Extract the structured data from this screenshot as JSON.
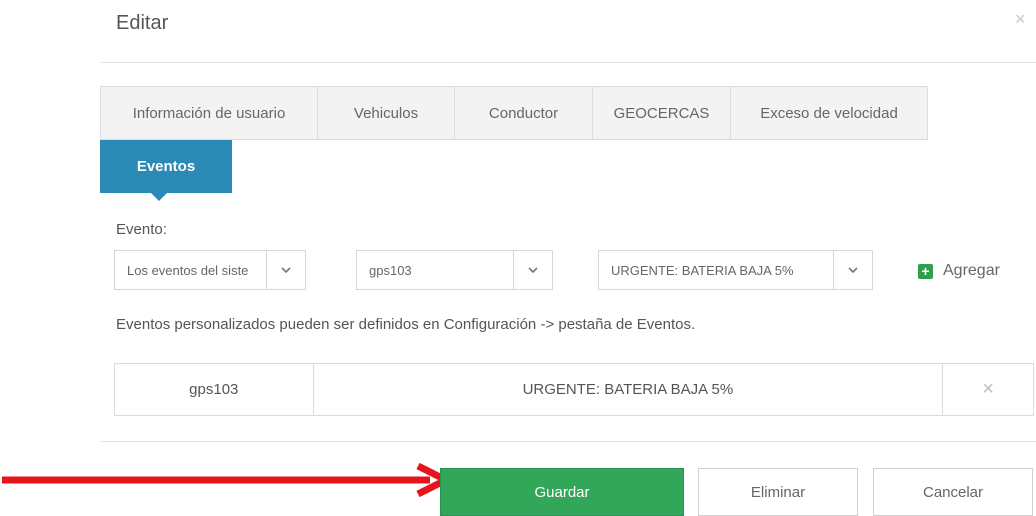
{
  "modal": {
    "title": "Editar",
    "close_glyph": "×",
    "close_icon": "close-icon"
  },
  "tabs": [
    {
      "label": "Información de usuario"
    },
    {
      "label": "Vehiculos"
    },
    {
      "label": "Conductor"
    },
    {
      "label": "GEOCERCAS"
    },
    {
      "label": "Exceso de velocidad"
    },
    {
      "label": "Eventos",
      "active": true
    }
  ],
  "form": {
    "event_label": "Evento:",
    "selects": [
      {
        "value": "Los eventos del siste",
        "icon": "chevron-down-icon"
      },
      {
        "value": "gps103",
        "icon": "chevron-down-icon"
      },
      {
        "value": "URGENTE: BATERIA BAJA 5%",
        "icon": "chevron-down-icon"
      }
    ],
    "add": {
      "label": "Agregar",
      "glyph": "+",
      "icon": "plus-square-icon"
    },
    "help_text": "Eventos personalizados pueden ser definidos en Configuración -> pestaña de Eventos."
  },
  "events_table": {
    "rows": [
      {
        "device": "gps103",
        "event": "URGENTE: BATERIA BAJA 5%",
        "remove_glyph": "×"
      }
    ]
  },
  "footer": {
    "save_label": "Guardar",
    "delete_label": "Eliminar",
    "cancel_label": "Cancelar"
  },
  "colors": {
    "active_tab": "#2b8ab5",
    "primary_button": "#33a759",
    "annotation_arrow": "#e8141c",
    "add_icon": "#2e9e4f"
  }
}
